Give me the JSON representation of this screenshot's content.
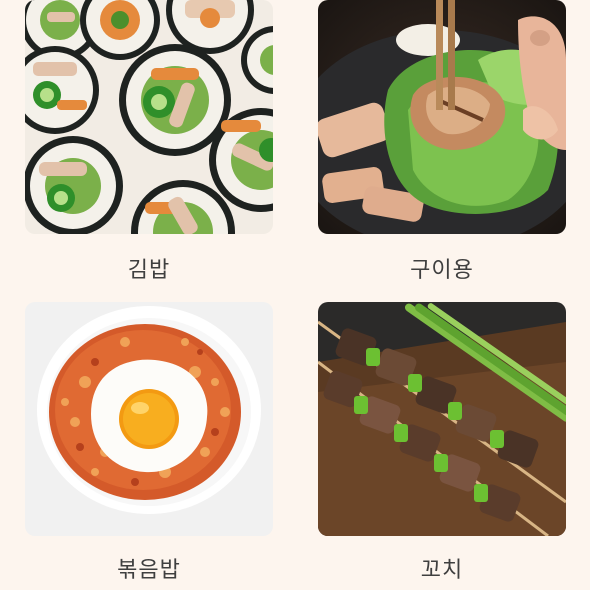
{
  "grid": {
    "items": [
      {
        "label": "김밥",
        "image": "kimbap-photo"
      },
      {
        "label": "구이용",
        "image": "grilled-pork-lettuce-wrap-photo"
      },
      {
        "label": "볶음밥",
        "image": "fried-rice-with-egg-photo"
      },
      {
        "label": "꼬치",
        "image": "skewers-photo"
      }
    ]
  }
}
